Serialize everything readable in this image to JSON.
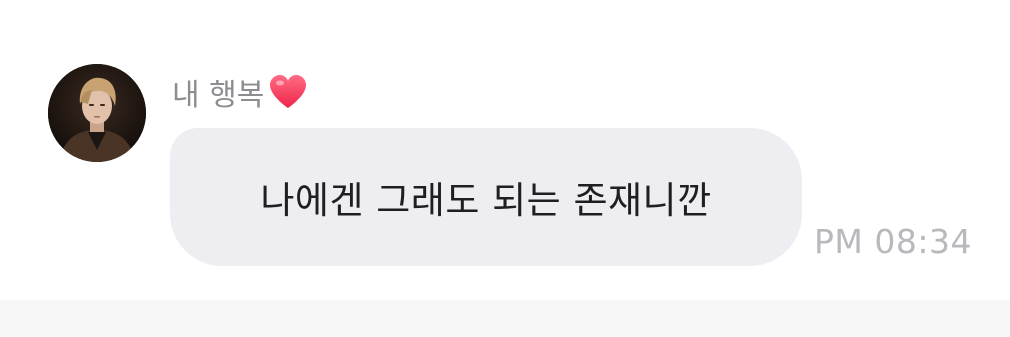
{
  "message": {
    "sender_name": "내 행복",
    "text": "나에겐 그래도 되는 존재니깐",
    "time": "PM 08:34",
    "sender_avatar_icon": "profile-photo",
    "name_suffix_icon": "heart-icon"
  },
  "colors": {
    "bubble_bg": "#eeeef2",
    "name_text": "#8c8c91",
    "message_text": "#1f1f22",
    "time_text": "#b8b8bd",
    "heart": "#ff3b5c"
  }
}
